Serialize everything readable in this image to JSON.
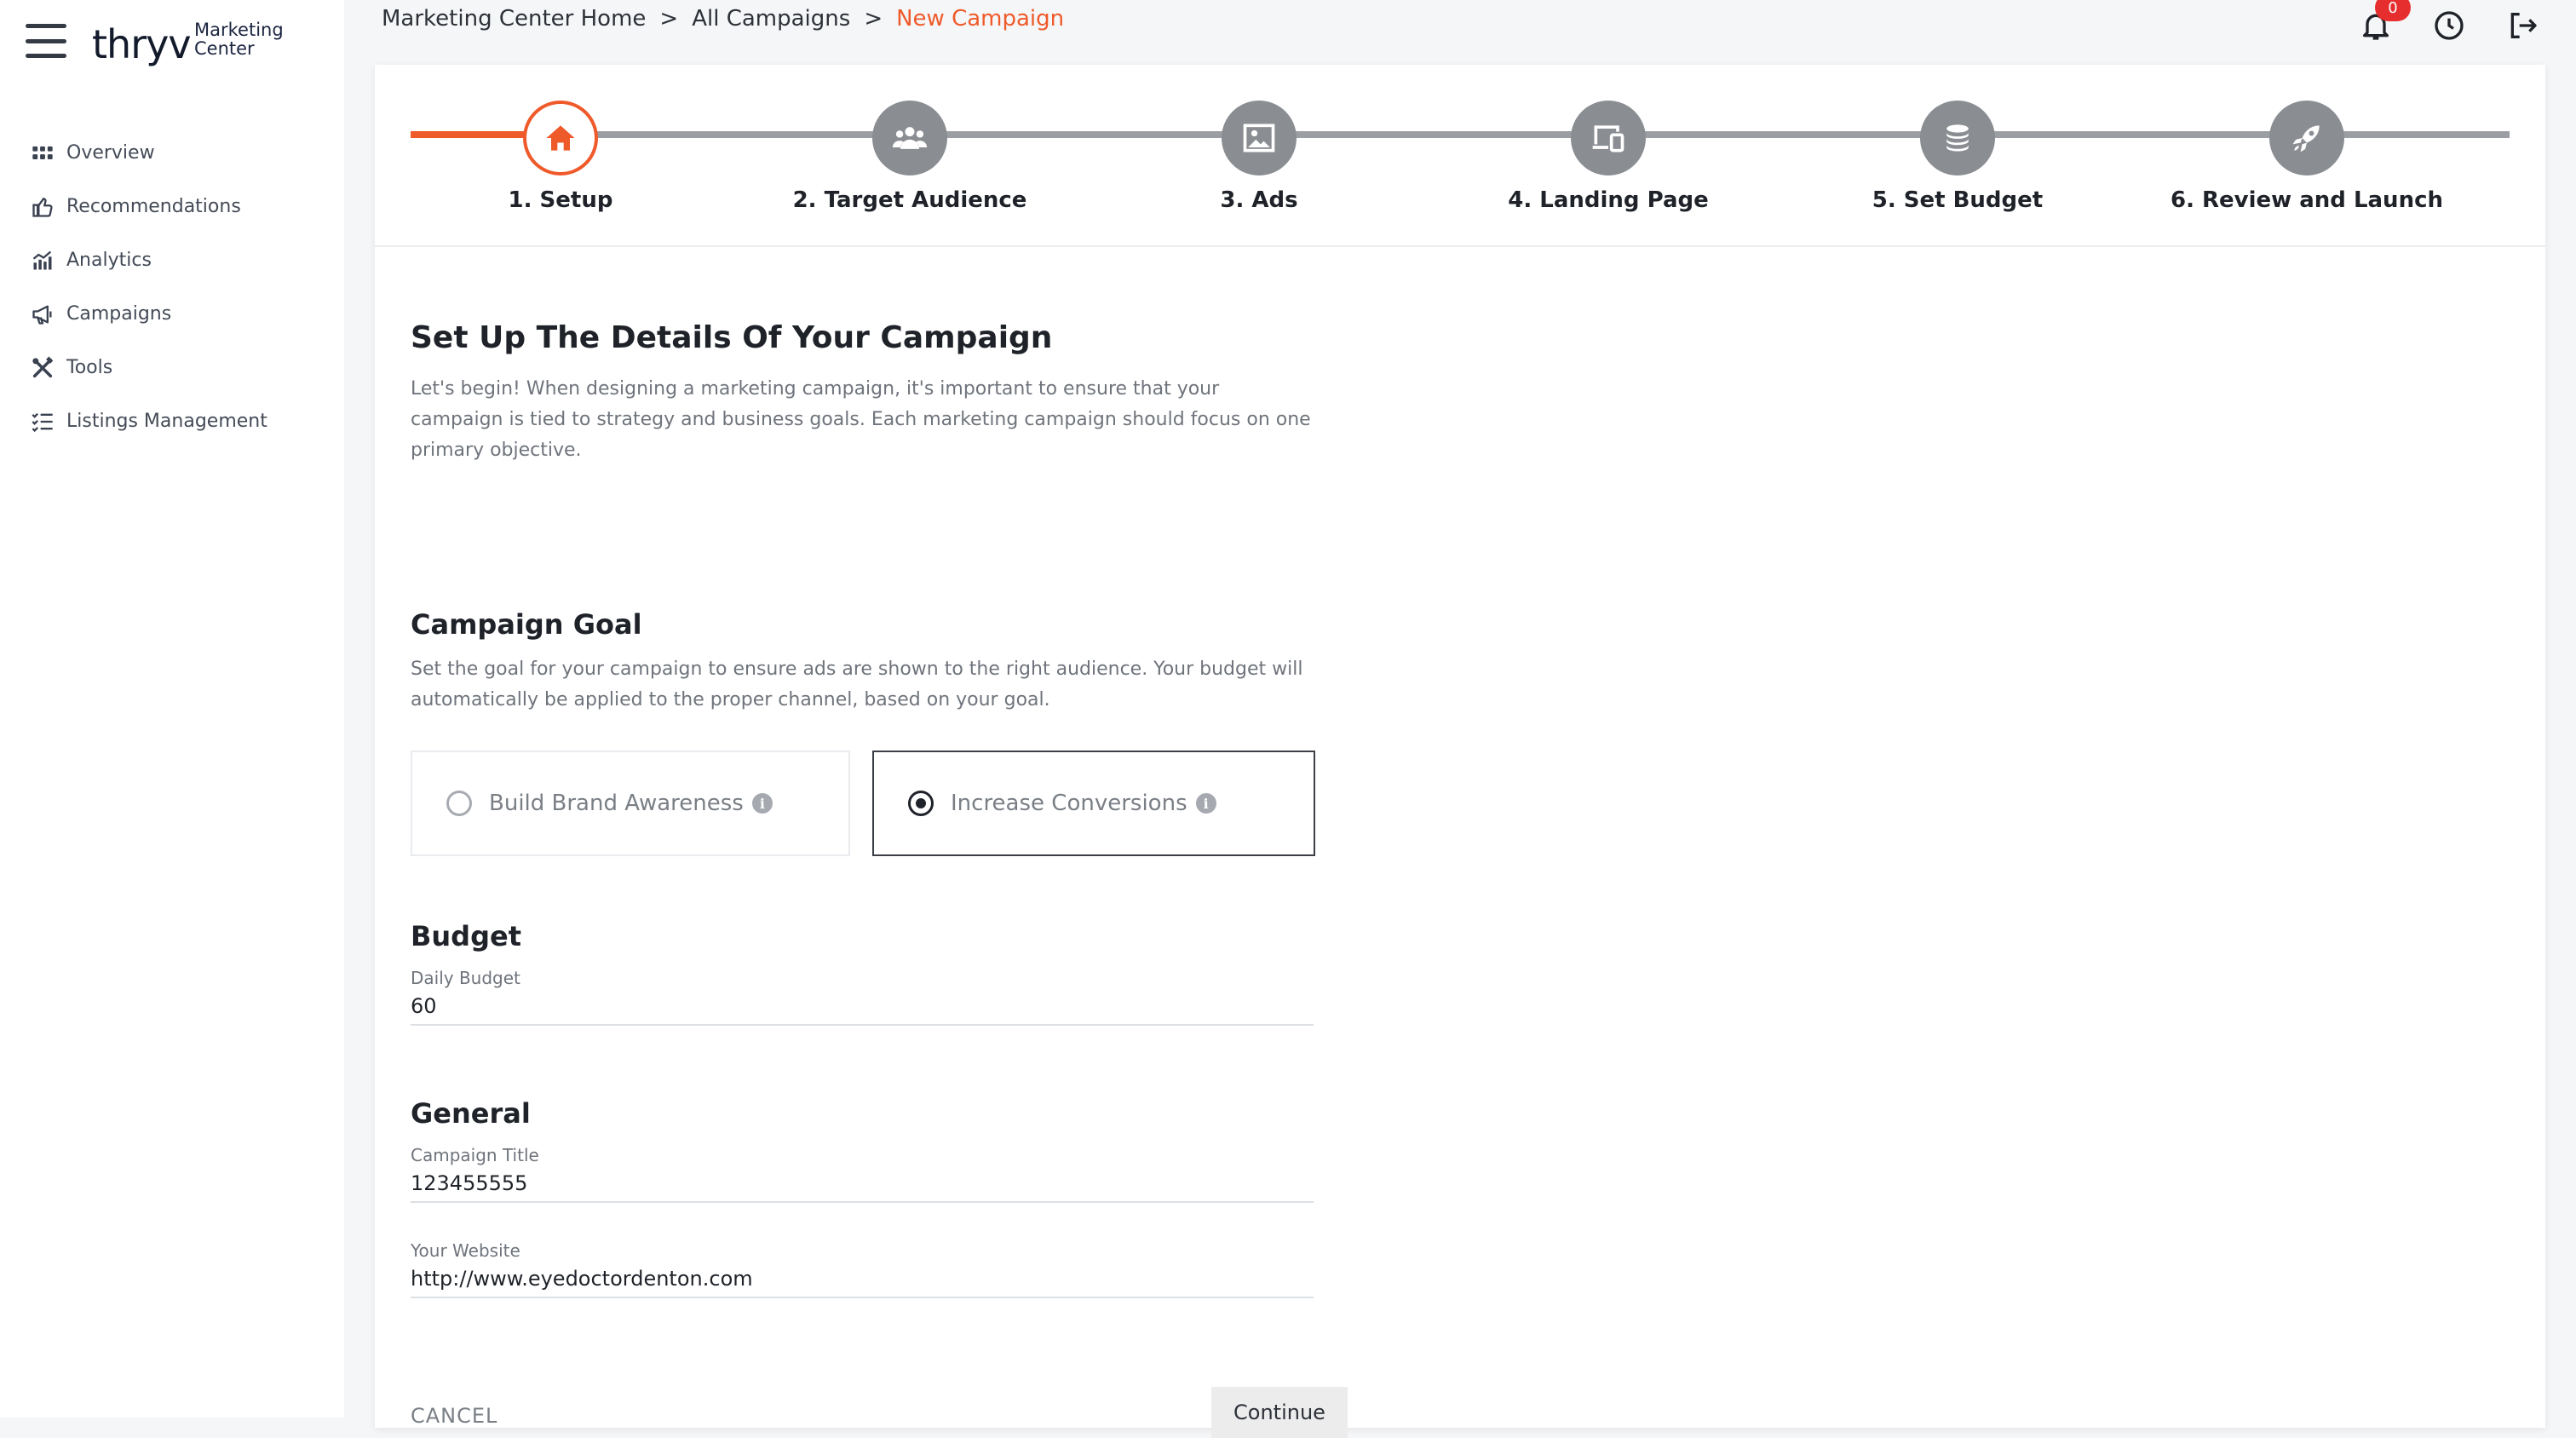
{
  "brand": {
    "logo_word": "thryv",
    "logo_sub": "Marketing Center",
    "accent": "#ef5a2a"
  },
  "sidebar": {
    "menu_icon": "hamburger-icon",
    "items": [
      {
        "label": "Overview",
        "icon": "grid-icon"
      },
      {
        "label": "Recommendations",
        "icon": "thumbs-up-icon"
      },
      {
        "label": "Analytics",
        "icon": "chart-icon"
      },
      {
        "label": "Campaigns",
        "icon": "megaphone-icon"
      },
      {
        "label": "Tools",
        "icon": "tools-icon"
      },
      {
        "label": "Listings Management",
        "icon": "checklist-icon"
      }
    ]
  },
  "breadcrumb": {
    "items": [
      "Marketing Center Home",
      "All Campaigns"
    ],
    "separator": ">",
    "current": "New Campaign"
  },
  "topbar": {
    "notifications_count": "0",
    "icons": [
      "bell-icon",
      "clock-icon",
      "logout-icon"
    ],
    "badge_color": "#e62e2e"
  },
  "stepper": {
    "steps": [
      {
        "label": "1. Setup",
        "icon": "home-icon"
      },
      {
        "label": "2. Target Audience",
        "icon": "users-icon"
      },
      {
        "label": "3. Ads",
        "icon": "image-icon"
      },
      {
        "label": "4. Landing Page",
        "icon": "devices-icon"
      },
      {
        "label": "5. Set Budget",
        "icon": "coins-icon"
      },
      {
        "label": "6. Review and Launch",
        "icon": "rocket-icon"
      }
    ],
    "active_index": 0
  },
  "setup": {
    "title": "Set Up The Details Of Your Campaign",
    "description": "Let's begin! When designing a marketing campaign, it's important to ensure that your campaign is tied to strategy and business goals. Each marketing campaign should focus on one primary objective."
  },
  "goal": {
    "title": "Campaign Goal",
    "description": "Set the goal for your campaign to ensure ads are shown to the right audience. Your budget will automatically be applied to the proper channel, based on your goal.",
    "options": [
      {
        "label": "Build Brand Awareness",
        "selected": false
      },
      {
        "label": "Increase Conversions",
        "selected": true
      }
    ]
  },
  "budget": {
    "title": "Budget",
    "daily_label": "Daily Budget",
    "daily_value": "60"
  },
  "general": {
    "title": "General",
    "campaign_title_label": "Campaign Title",
    "campaign_title_value": "123455555",
    "website_label": "Your Website",
    "website_value": "http://www.eyedoctordenton.com"
  },
  "actions": {
    "cancel": "CANCEL",
    "continue": "Continue"
  }
}
